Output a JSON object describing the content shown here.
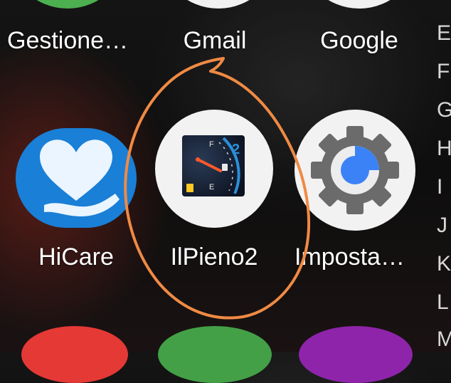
{
  "apps": {
    "row1": [
      {
        "label": "Gestione…",
        "icon": "gestione-icon"
      },
      {
        "label": "Gmail",
        "icon": "gmail-icon"
      },
      {
        "label": "Google",
        "icon": "google-icon"
      }
    ],
    "row2": [
      {
        "label": "HiCare",
        "icon": "heart-hand-icon"
      },
      {
        "label": "IlPieno2",
        "icon": "fuel-gauge-icon"
      },
      {
        "label": "Imposta…",
        "icon": "gear-icon"
      }
    ]
  },
  "gauge": {
    "number": "2",
    "full_mark": "F",
    "empty_mark": "E"
  },
  "alphabet_index": [
    "E",
    "F",
    "G",
    "H",
    "I",
    "J",
    "K",
    "L",
    "M"
  ],
  "colors": {
    "annotation": "#f08a44",
    "hicare_blue": "#1a7fd6",
    "settings_blue": "#3b82f6",
    "gear_gray": "#6b6b6b"
  }
}
